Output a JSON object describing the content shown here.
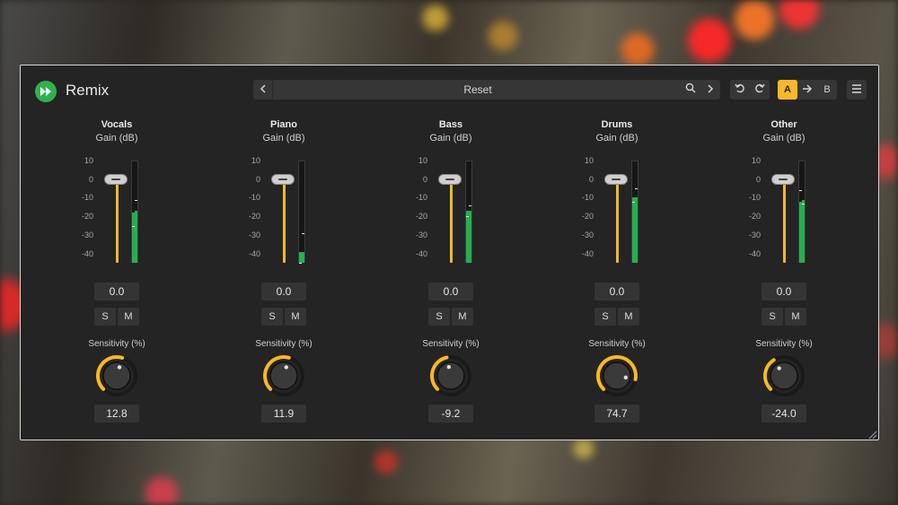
{
  "header": {
    "app_title": "Remix",
    "preset_name": "Reset",
    "ab_a": "A",
    "ab_b": "B"
  },
  "scale_ticks": [
    "10",
    "0",
    "-10",
    "-20",
    "-30",
    "-40"
  ],
  "channels": [
    {
      "name": "Vocals",
      "gain_label": "Gain (dB)",
      "gain_value": "0.0",
      "solo": "S",
      "mute": "M",
      "sensitivity_label": "Sensitivity (%)",
      "sensitivity_value": "12.8",
      "sensitivity": 12.8,
      "gain_db": 0.0,
      "meter_left_db": -18,
      "meter_right_db": -17,
      "peak_left_db": -25,
      "peak_right_db": -11
    },
    {
      "name": "Piano",
      "gain_label": "Gain (dB)",
      "gain_value": "0.0",
      "solo": "S",
      "mute": "M",
      "sensitivity_label": "Sensitivity (%)",
      "sensitivity_value": "11.9",
      "sensitivity": 11.9,
      "gain_db": 0.0,
      "meter_left_db": -39,
      "meter_right_db": -39,
      "peak_left_db": -45,
      "peak_right_db": -29
    },
    {
      "name": "Bass",
      "gain_label": "Gain (dB)",
      "gain_value": "0.0",
      "solo": "S",
      "mute": "M",
      "sensitivity_label": "Sensitivity (%)",
      "sensitivity_value": "-9.2",
      "sensitivity": -9.2,
      "gain_db": 0.0,
      "meter_left_db": -17,
      "meter_right_db": -17,
      "peak_left_db": -20,
      "peak_right_db": -14
    },
    {
      "name": "Drums",
      "gain_label": "Gain (dB)",
      "gain_value": "0.0",
      "solo": "S",
      "mute": "M",
      "sensitivity_label": "Sensitivity (%)",
      "sensitivity_value": "74.7",
      "sensitivity": 74.7,
      "gain_db": 0.0,
      "meter_left_db": -10,
      "meter_right_db": -10,
      "peak_left_db": -12,
      "peak_right_db": -5
    },
    {
      "name": "Other",
      "gain_label": "Gain (dB)",
      "gain_value": "0.0",
      "solo": "S",
      "mute": "M",
      "sensitivity_label": "Sensitivity (%)",
      "sensitivity_value": "-24.0",
      "sensitivity": -24.0,
      "gain_db": 0.0,
      "meter_left_db": -12,
      "meter_right_db": -11,
      "peak_left_db": -6,
      "peak_right_db": -13
    }
  ],
  "colors": {
    "accent": "#f7b829",
    "meter": "#22b14c",
    "logo": "#2fb24c",
    "panel": "#242424"
  },
  "icons": {
    "logo": "fast-forward-icon",
    "prev": "chevron-left-icon",
    "next": "chevron-right-icon",
    "search": "search-icon",
    "undo": "undo-icon",
    "redo": "redo-icon",
    "ab_arrow": "arrow-right-icon",
    "menu": "hamburger-menu-icon",
    "resize": "resize-grip-icon"
  }
}
